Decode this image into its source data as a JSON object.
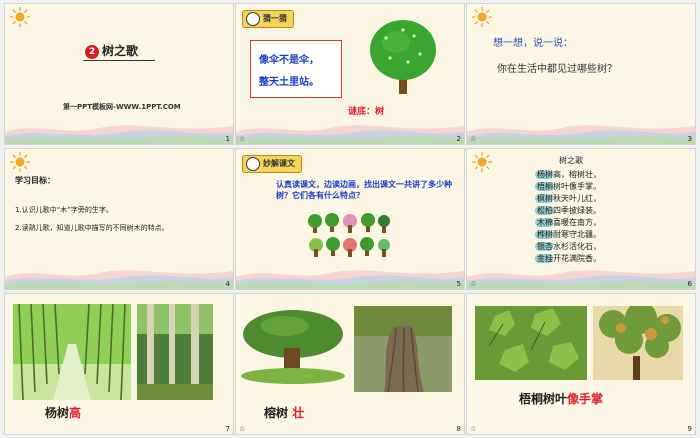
{
  "slides": [
    {
      "number": "1",
      "title": "树之歌",
      "badge": "2",
      "footer": "第一PPT模板网-WWW.1PPT.COM"
    },
    {
      "number": "2",
      "tag": "猜一猜",
      "riddle_line1": "像伞不是伞，",
      "riddle_line2": "整天土里站。",
      "answer": "谜底：树",
      "mark": "☆"
    },
    {
      "number": "3",
      "heading": "想一想，说一说：",
      "question": "你在生活中都见过哪些树？",
      "mark": "☆"
    },
    {
      "number": "4",
      "heading": "学习目标：",
      "items": [
        "1.认识儿歌中“木”字旁的生字。",
        "2.读熟儿歌，知道儿歌中描写的不同树木的特点。"
      ]
    },
    {
      "number": "5",
      "tag": "妙解课文",
      "text": "认真读课文，边读边画，找出课文一共讲了多少种树？它们各有什么特点？"
    },
    {
      "number": "6",
      "poem_title": "树之歌",
      "poem_lines": [
        "杨树高，榕树壮，",
        "梧桐树叶像手掌。",
        "枫树秋天叶儿红，",
        "松柏四季披绿装。",
        "木棉喜暖在南方，",
        "桦树耐寒守北疆。",
        "银杏水杉活化石，",
        "金桂开花满院香。"
      ],
      "mark": "☆"
    },
    {
      "number": "7",
      "caption": "杨树",
      "caption_hi": "高"
    },
    {
      "number": "8",
      "caption": "榕树 ",
      "caption_hi": "壮",
      "mark": "☆"
    },
    {
      "number": "9",
      "caption": "梧桐树叶",
      "caption_hi": "像手掌",
      "mark": "☆"
    }
  ],
  "colors": {
    "accent_red": "#e0202f",
    "accent_blue": "#1a3ccc",
    "slide_bg": "#fcf6e4"
  }
}
